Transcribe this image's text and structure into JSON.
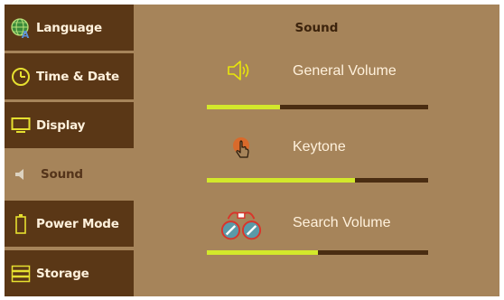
{
  "sidebar": {
    "items": [
      {
        "label": "Language",
        "icon": "globe-language-icon",
        "active": false
      },
      {
        "label": "Time & Date",
        "icon": "clock-icon",
        "active": false
      },
      {
        "label": "Display",
        "icon": "monitor-icon",
        "active": false
      },
      {
        "label": "Sound",
        "icon": "speaker-icon",
        "active": true
      },
      {
        "label": "Power Mode",
        "icon": "battery-icon",
        "active": false
      },
      {
        "label": "Storage",
        "icon": "storage-icon",
        "active": false
      }
    ]
  },
  "main": {
    "title": "Sound",
    "settings": [
      {
        "label": "General Volume",
        "icon": "speaker-volume-icon",
        "level": 0.33
      },
      {
        "label": "Keytone",
        "icon": "touch-hand-icon",
        "level": 0.67
      },
      {
        "label": "Search Volume",
        "icon": "binoculars-icon",
        "level": 0.5
      }
    ]
  },
  "colors": {
    "sidebar_bg": "#5a3716",
    "main_bg": "#a6845a",
    "slider_track": "#4a2d12",
    "slider_fill": "#d3e82b",
    "icon_accent": "#e8e60a"
  }
}
